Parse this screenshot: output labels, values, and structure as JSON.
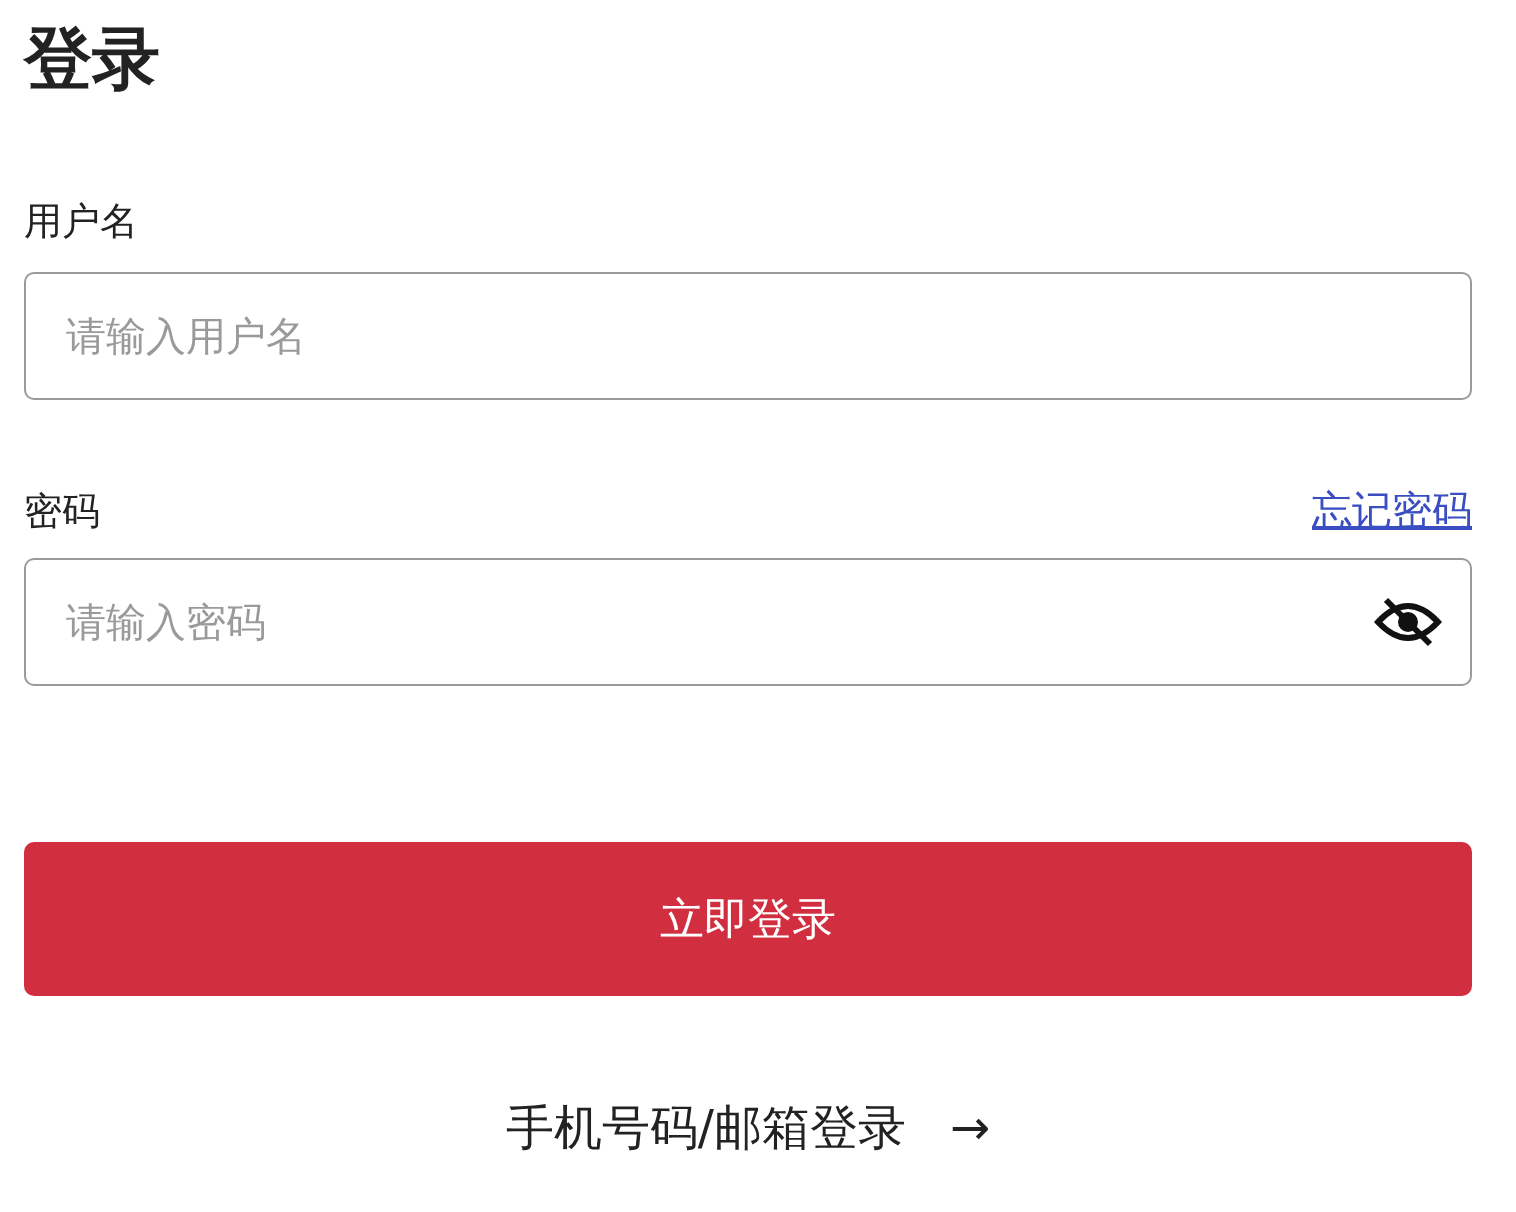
{
  "title": "登录",
  "username": {
    "label": "用户名",
    "placeholder": "请输入用户名"
  },
  "password": {
    "label": "密码",
    "forgot_link": "忘记密码",
    "placeholder": "请输入密码",
    "visible": false
  },
  "submit_button": "立即登录",
  "alt_login": {
    "label": "手机号码/邮箱登录",
    "arrow": "→"
  }
}
